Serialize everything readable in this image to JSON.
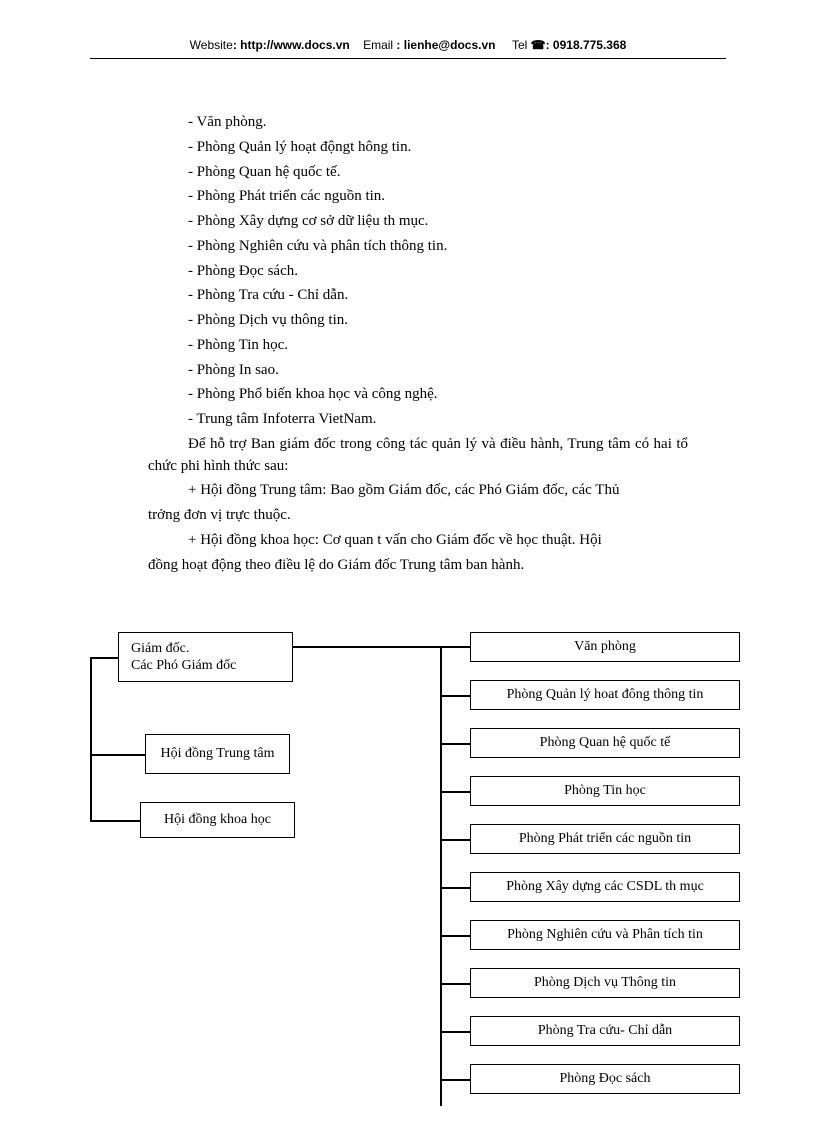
{
  "header": {
    "websiteLabel": "Website",
    "websiteUrl": "http://www.docs.vn",
    "emailLabel": "Email",
    "emailAddr": "lienhe@docs.vn",
    "telLabel": "Tel",
    "telNum": "0918.775.368"
  },
  "list": [
    "- Văn phòng.",
    "- Phòng Quản lý hoạt độngt hông tin.",
    "- Phòng Quan hệ quốc tế.",
    "- Phòng Phát triển các nguồn tin.",
    "- Phòng Xây dựng cơ sở dữ liệu th   mục.",
    "- Phòng Nghiên cứu và phân tích thông tin.",
    "- Phòng Đọc sách.",
    "- Phòng Tra cứu - Chỉ dẫn.",
    "- Phòng Dịch vụ thông tin.",
    "- Phòng Tin học.",
    "- Phòng In sao.",
    "- Phòng Phổ biến khoa học và công nghệ.",
    "- Trung tâm Infoterra VietNam."
  ],
  "para1": "Để hỗ trợ Ban giám đốc trong công tác quản lý và điều hành, Trung tâm có hai tổ chức phi hình thức sau:",
  "plus1a": "+ Hội đồng Trung tâm: Bao gồm Giám đốc, các Phó Giám đốc, các Thủ",
  "plus1b": "trởng   đơn vị trực thuộc.",
  "plus2a": "+ Hội đồng khoa học: Cơ quan t   vấn cho Giám đốc về học thuật. Hội",
  "plus2b": "đồng hoạt động theo điều lệ do Giám đốc Trung tâm ban hành.",
  "chart_data": {
    "type": "org-chart",
    "left_boxes": [
      {
        "id": "director",
        "lines": [
          "Giám đốc.",
          "Các Phó Giám đốc"
        ]
      },
      {
        "id": "council-center",
        "label": "Hội đồng Trung tâm"
      },
      {
        "id": "council-science",
        "label": "Hội đồng khoa học"
      }
    ],
    "right_boxes": [
      "Văn phòng",
      "Phòng Quản lý hoat đông thông tin",
      "Phòng Quan hệ quốc tế",
      "Phòng Tin học",
      "Phòng Phát triển các nguồn tin",
      "Phòng Xây dựng các CSDL th   mục",
      "Phòng Nghiên cứu và Phân tích tin",
      "Phòng Dịch vụ Thông tin",
      "Phòng Tra cứu- Chỉ dẫn",
      "Phòng Đọc sách"
    ]
  }
}
